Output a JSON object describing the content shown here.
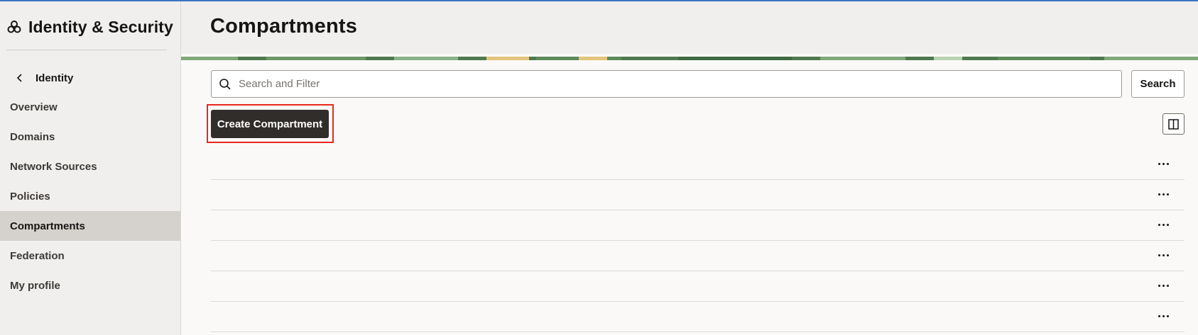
{
  "sidebar": {
    "brand_icon": "oci-identity-icon",
    "brand_title": "Identity & Security",
    "back_label": "Identity",
    "items": [
      {
        "label": "Overview",
        "active": false
      },
      {
        "label": "Domains",
        "active": false
      },
      {
        "label": "Network Sources",
        "active": false
      },
      {
        "label": "Policies",
        "active": false
      },
      {
        "label": "Compartments",
        "active": true
      },
      {
        "label": "Federation",
        "active": false
      },
      {
        "label": "My profile",
        "active": false
      }
    ]
  },
  "header": {
    "title": "Compartments"
  },
  "search": {
    "placeholder": "Search and Filter",
    "value": "",
    "button_label": "Search"
  },
  "toolbar": {
    "create_label": "Create Compartment",
    "columns_icon": "columns-icon"
  },
  "table": {
    "row_count": 6,
    "row_action_icon": "more-actions-icon"
  },
  "colors": {
    "accent_highlight": "#e8281d",
    "primary_button": "#312d2a",
    "active_nav": "#d5d1cd"
  }
}
